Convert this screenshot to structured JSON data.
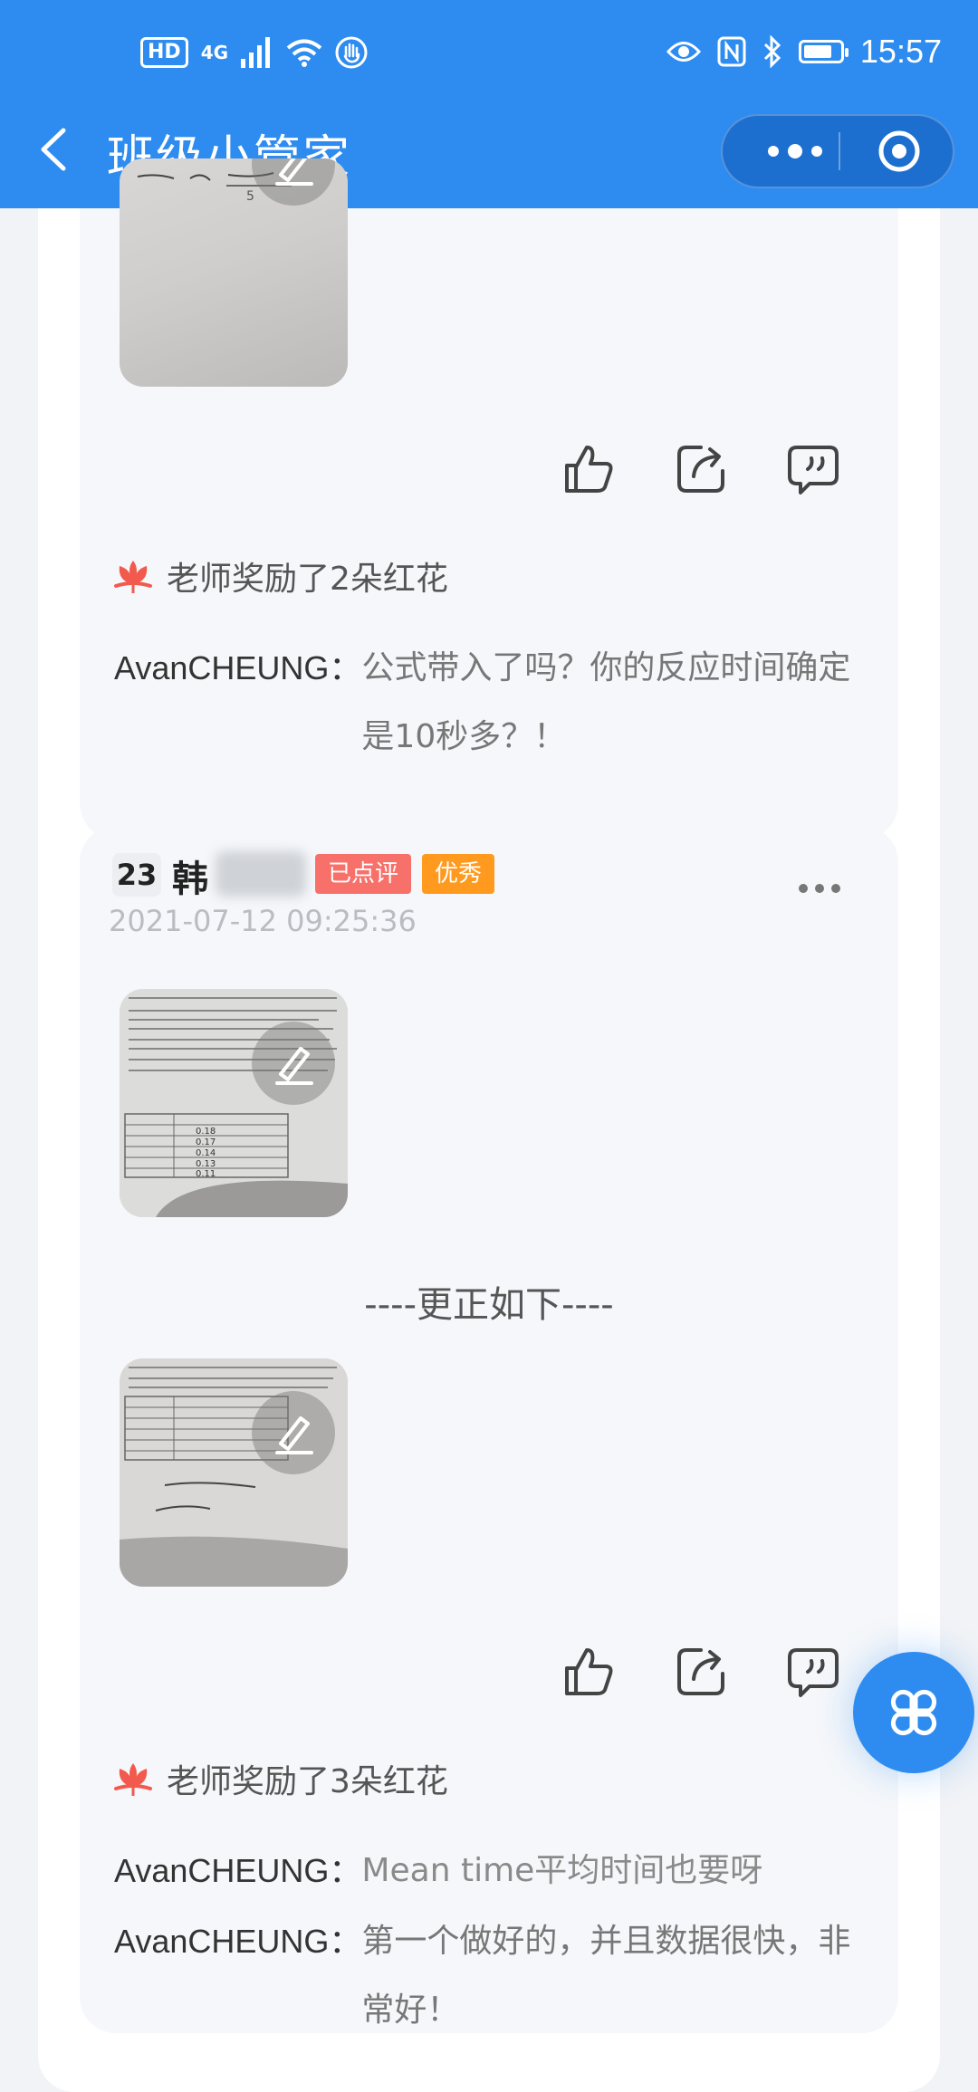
{
  "status_bar": {
    "hd_label": "HD",
    "network_label": "4G",
    "time": "15:57",
    "battery_level": 0.8
  },
  "nav": {
    "title": "班级小管家",
    "back_icon": "chevron-left-icon",
    "more_icon": "more-dots-icon",
    "close_icon": "target-icon"
  },
  "posts": [
    {
      "award_text": "老师奖励了2朵红花",
      "comments": [
        {
          "user": "AvanCHEUNG：",
          "text": "公式带入了吗？你的反应时间确定是10秒多？！"
        }
      ]
    },
    {
      "seat_number": "23",
      "student_name": "韩",
      "tag_reviewed": "已点评",
      "tag_excellent": "优秀",
      "timestamp": "2021-07-12 09:25:36",
      "correction_label": "----更正如下----",
      "award_text": "老师奖励了3朵红花",
      "comments": [
        {
          "user": "AvanCHEUNG：",
          "text": "Mean time平均时间也要呀"
        },
        {
          "user": "AvanCHEUNG：",
          "text": "第一个做好的，并且数据很快，非常好！"
        }
      ]
    }
  ],
  "icons": {
    "like": "thumbs-up-icon",
    "share": "share-icon",
    "comment": "quote-bubble-icon",
    "flower": "flower-icon",
    "fab": "grid-clover-icon",
    "edit": "pencil-icon"
  },
  "colors": {
    "brand_blue": "#2e8cf0",
    "badge_red": "#f7706a",
    "badge_orange": "#ff9a1f",
    "flower_red": "#f25a4e"
  }
}
